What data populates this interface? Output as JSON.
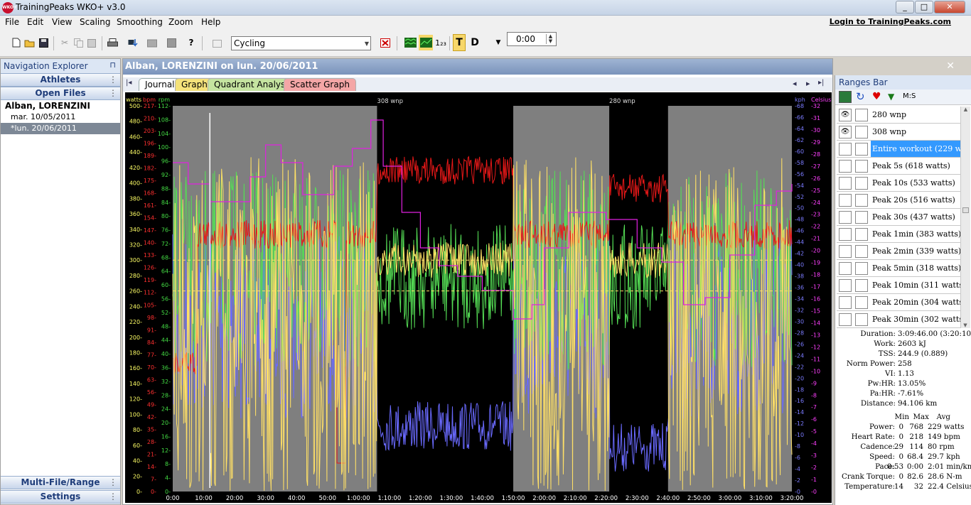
{
  "window": {
    "title": "TrainingPeaks WKO+ v3.0",
    "app_icon_text": "WKO+",
    "minimize": "_",
    "maximize": "□",
    "close": "✕"
  },
  "menu": {
    "items": [
      "File",
      "Edit",
      "View",
      "Scaling",
      "Smoothing",
      "Zoom",
      "Help"
    ],
    "login_link": "Login to TrainingPeaks.com"
  },
  "toolbar": {
    "sport": "Cycling",
    "time": "0:00",
    "t_label": "T",
    "d_label": "D",
    "num_label": "1₂₃"
  },
  "nav": {
    "title": "Navigation Explorer",
    "pin": "⊓",
    "sections": {
      "athletes": "Athletes",
      "open_files": "Open Files",
      "multi_file": "Multi-File/Range Analysis",
      "settings": "Settings"
    },
    "athlete": "Alban, LORENZINI",
    "files": [
      "mar. 10/05/2011",
      "*lun. 20/06/2011"
    ]
  },
  "workout": {
    "title": "Alban, LORENZINI on lun. 20/06/2011",
    "close": "✕"
  },
  "tabs": [
    "Journal",
    "Graph",
    "Quadrant Analysis",
    "Scatter Graph"
  ],
  "tab_nav": {
    "first": "|◂",
    "prev": "◂",
    "next": "▸",
    "last": "▸|"
  },
  "chart_data": {
    "type": "line",
    "x_unit": "time",
    "xlim": [
      "0:00",
      "3:20:00"
    ],
    "x_ticks": [
      "0:00",
      "10:00",
      "20:00",
      "30:00",
      "40:00",
      "50:00",
      "1:00:00",
      "1:10:00",
      "1:20:00",
      "1:30:00",
      "1:40:00",
      "1:50:00",
      "2:00:00",
      "2:10:00",
      "2:20:00",
      "2:30:00",
      "2:40:00",
      "2:50:00",
      "3:00:00",
      "3:10:00",
      "3:20:00"
    ],
    "axes": [
      {
        "name": "watts",
        "color": "#ffff66",
        "ticks": [
          "500-",
          "480-",
          "460-",
          "440-",
          "420-",
          "400-",
          "380-",
          "360-",
          "340-",
          "320-",
          "300-",
          "280-",
          "260-",
          "240-",
          "220-",
          "200-",
          "180-",
          "160-",
          "140-",
          "120-",
          "100-",
          "80-",
          "60-",
          "40-",
          "20-",
          "0-"
        ]
      },
      {
        "name": "bpm",
        "color": "#ff3030",
        "ticks": [
          "217-",
          "210-",
          "203-",
          "196-",
          "189-",
          "182-",
          "175-",
          "168-",
          "161-",
          "154-",
          "147-",
          "140-",
          "133-",
          "126-",
          "119-",
          "112-",
          "105-",
          "98-",
          "91-",
          "84-",
          "77-",
          "70-",
          "63-",
          "56-",
          "49-",
          "42-",
          "35-",
          "28-",
          "21-",
          "14-",
          "7-",
          "0-"
        ]
      },
      {
        "name": "rpm",
        "color": "#44dd44",
        "ticks": [
          "112-",
          "108-",
          "104-",
          "100-",
          "96-",
          "92-",
          "88-",
          "84-",
          "80-",
          "76-",
          "72-",
          "68-",
          "64-",
          "60-",
          "56-",
          "52-",
          "48-",
          "44-",
          "40-",
          "36-",
          "32-",
          "28-",
          "24-",
          "20-",
          "16-",
          "12-",
          "8-",
          "4-",
          "0-"
        ]
      },
      {
        "name": "kph",
        "color": "#7b7bff",
        "ticks": [
          "-68",
          "-66",
          "-64",
          "-62",
          "-60",
          "-58",
          "-56",
          "-54",
          "-52",
          "-50",
          "-48",
          "-46",
          "-44",
          "-42",
          "-40",
          "-38",
          "-36",
          "-34",
          "-32",
          "-30",
          "-28",
          "-26",
          "-24",
          "-22",
          "-20",
          "-18",
          "-16",
          "-14",
          "-12",
          "-10",
          "-8",
          "-6",
          "-4",
          "-2",
          "-0"
        ]
      },
      {
        "name": "Celsius",
        "color": "#ff40ff",
        "ticks": [
          "-32",
          "-31",
          "-30",
          "-29",
          "-28",
          "-27",
          "-26",
          "-25",
          "-24",
          "-23",
          "-22",
          "-21",
          "-20",
          "-19",
          "-18",
          "-17",
          "-16",
          "-15",
          "-14",
          "-13",
          "-12",
          "-11",
          "-10",
          "-9",
          "-8",
          "-7",
          "-6",
          "-5",
          "-4",
          "-3",
          "-2",
          "-1",
          "-0"
        ]
      }
    ],
    "ranges": [
      {
        "label": "308 wnp",
        "start_min": 66,
        "end_min": 110
      },
      {
        "label": "280 wnp",
        "start_min": 141,
        "end_min": 160
      }
    ],
    "reference_lines_watts": [
      300,
      260
    ],
    "series": [
      {
        "name": "watts",
        "color": "#ffe066"
      },
      {
        "name": "bpm",
        "color": "#e81818"
      },
      {
        "name": "rpm",
        "color": "#55dd55"
      },
      {
        "name": "kph",
        "color": "#6a6aff"
      },
      {
        "name": "Celsius",
        "color": "#e020e0"
      }
    ]
  },
  "ranges_bar": {
    "title": "Ranges Bar",
    "tool_ms": "M:S",
    "items": [
      {
        "label": "280 wnp",
        "eye": true,
        "selected": false
      },
      {
        "label": "308 wnp",
        "eye": true,
        "selected": false
      },
      {
        "label": "Entire workout (229 watts)",
        "eye": false,
        "selected": true
      },
      {
        "label": "Peak 5s (618 watts)",
        "eye": false,
        "selected": false
      },
      {
        "label": "Peak 10s (533 watts)",
        "eye": false,
        "selected": false
      },
      {
        "label": "Peak 20s (516 watts)",
        "eye": false,
        "selected": false
      },
      {
        "label": "Peak 30s (437 watts)",
        "eye": false,
        "selected": false
      },
      {
        "label": "Peak 1min (383 watts)",
        "eye": false,
        "selected": false
      },
      {
        "label": "Peak 2min (339 watts)",
        "eye": false,
        "selected": false
      },
      {
        "label": "Peak 5min (318 watts)",
        "eye": false,
        "selected": false
      },
      {
        "label": "Peak 10min (311 watts)",
        "eye": false,
        "selected": false
      },
      {
        "label": "Peak 20min (304 watts)",
        "eye": false,
        "selected": false
      },
      {
        "label": "Peak 30min (302 watts)",
        "eye": false,
        "selected": false
      }
    ]
  },
  "summary": [
    {
      "label": "Duration:",
      "value": "3:09:46.00 (3:20:10.00)"
    },
    {
      "label": "Work:",
      "value": "2603 kJ"
    },
    {
      "label": "TSS:",
      "value": "244.9 (0.889)"
    },
    {
      "label": "Norm Power:",
      "value": "258"
    },
    {
      "label": "VI:",
      "value": "1.13"
    },
    {
      "label": "Pw:HR:",
      "value": "13.05%"
    },
    {
      "label": "Pa:HR:",
      "value": "-7.61%"
    },
    {
      "label": "Distance:",
      "value": "94.106 km"
    }
  ],
  "stats_headers": [
    "Min",
    "Max",
    "Avg"
  ],
  "stats": [
    {
      "label": "Power:",
      "min": "0",
      "max": "768",
      "avg": "229 watts"
    },
    {
      "label": "Heart Rate:",
      "min": "0",
      "max": "218",
      "avg": "149 bpm"
    },
    {
      "label": "Cadence:",
      "min": "29",
      "max": "114",
      "avg": "80 rpm"
    },
    {
      "label": "Speed:",
      "min": "0",
      "max": "68.4",
      "avg": "29.7 kph"
    },
    {
      "label": "Pace:",
      "min": "0:53",
      "max": "0:00",
      "avg": "2:01 min/km"
    },
    {
      "label": "Crank Torque:",
      "min": "0",
      "max": "82.6",
      "avg": "28.6 N-m"
    },
    {
      "label": "Temperature:",
      "min": "14",
      "max": "32",
      "avg": "22.4 Celsius"
    }
  ]
}
